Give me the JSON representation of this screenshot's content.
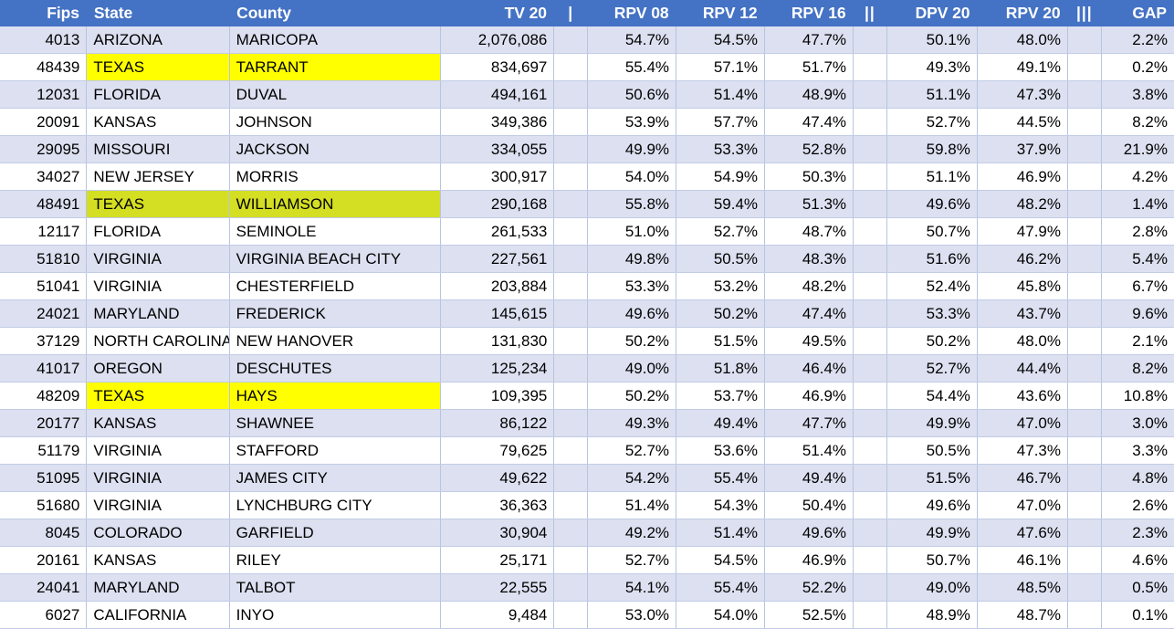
{
  "table": {
    "columns": [
      {
        "key": "fips",
        "label": "Fips",
        "align": "num",
        "type": "data"
      },
      {
        "key": "state",
        "label": "State",
        "align": "txt",
        "type": "data"
      },
      {
        "key": "county",
        "label": "County",
        "align": "txt",
        "type": "data"
      },
      {
        "key": "tv20",
        "label": "TV 20",
        "align": "num",
        "type": "data"
      },
      {
        "key": "sep1",
        "label": "|",
        "align": "sepc",
        "type": "separator"
      },
      {
        "key": "rpv08",
        "label": "RPV 08",
        "align": "num",
        "type": "data"
      },
      {
        "key": "rpv12",
        "label": "RPV 12",
        "align": "num",
        "type": "data"
      },
      {
        "key": "rpv16",
        "label": "RPV 16",
        "align": "num",
        "type": "data"
      },
      {
        "key": "sep2",
        "label": "||",
        "align": "sepc",
        "type": "separator"
      },
      {
        "key": "dpv20",
        "label": "DPV 20",
        "align": "num",
        "type": "data"
      },
      {
        "key": "rpv20",
        "label": "RPV 20",
        "align": "num",
        "type": "data"
      },
      {
        "key": "sep3",
        "label": "|||",
        "align": "sepc",
        "type": "separator"
      },
      {
        "key": "gap",
        "label": "GAP",
        "align": "num",
        "type": "data"
      }
    ],
    "colors": {
      "header_background": "#4472C4",
      "header_text": "#FFFFFF",
      "row_alt_background": "#DCE0F0",
      "row_plain_background": "#FFFFFF",
      "highlight_yellow": "#FFFF00",
      "highlight_olive": "#D4DE23",
      "gridline": "#B8C4E0"
    },
    "rows": [
      {
        "fips": "4013",
        "state": "ARIZONA",
        "county": "MARICOPA",
        "tv20": "2,076,086",
        "sep1": "",
        "rpv08": "54.7%",
        "rpv12": "54.5%",
        "rpv16": "47.7%",
        "sep2": "",
        "dpv20": "50.1%",
        "rpv20": "48.0%",
        "sep3": "",
        "gap": "2.2%",
        "highlight": ""
      },
      {
        "fips": "48439",
        "state": "TEXAS",
        "county": "TARRANT",
        "tv20": "834,697",
        "sep1": "",
        "rpv08": "55.4%",
        "rpv12": "57.1%",
        "rpv16": "51.7%",
        "sep2": "",
        "dpv20": "49.3%",
        "rpv20": "49.1%",
        "sep3": "",
        "gap": "0.2%",
        "highlight": "yellow"
      },
      {
        "fips": "12031",
        "state": "FLORIDA",
        "county": "DUVAL",
        "tv20": "494,161",
        "sep1": "",
        "rpv08": "50.6%",
        "rpv12": "51.4%",
        "rpv16": "48.9%",
        "sep2": "",
        "dpv20": "51.1%",
        "rpv20": "47.3%",
        "sep3": "",
        "gap": "3.8%",
        "highlight": ""
      },
      {
        "fips": "20091",
        "state": "KANSAS",
        "county": "JOHNSON",
        "tv20": "349,386",
        "sep1": "",
        "rpv08": "53.9%",
        "rpv12": "57.7%",
        "rpv16": "47.4%",
        "sep2": "",
        "dpv20": "52.7%",
        "rpv20": "44.5%",
        "sep3": "",
        "gap": "8.2%",
        "highlight": ""
      },
      {
        "fips": "29095",
        "state": "MISSOURI",
        "county": "JACKSON",
        "tv20": "334,055",
        "sep1": "",
        "rpv08": "49.9%",
        "rpv12": "53.3%",
        "rpv16": "52.8%",
        "sep2": "",
        "dpv20": "59.8%",
        "rpv20": "37.9%",
        "sep3": "",
        "gap": "21.9%",
        "highlight": ""
      },
      {
        "fips": "34027",
        "state": "NEW JERSEY",
        "county": "MORRIS",
        "tv20": "300,917",
        "sep1": "",
        "rpv08": "54.0%",
        "rpv12": "54.9%",
        "rpv16": "50.3%",
        "sep2": "",
        "dpv20": "51.1%",
        "rpv20": "46.9%",
        "sep3": "",
        "gap": "4.2%",
        "highlight": ""
      },
      {
        "fips": "48491",
        "state": "TEXAS",
        "county": "WILLIAMSON",
        "tv20": "290,168",
        "sep1": "",
        "rpv08": "55.8%",
        "rpv12": "59.4%",
        "rpv16": "51.3%",
        "sep2": "",
        "dpv20": "49.6%",
        "rpv20": "48.2%",
        "sep3": "",
        "gap": "1.4%",
        "highlight": "olive"
      },
      {
        "fips": "12117",
        "state": "FLORIDA",
        "county": "SEMINOLE",
        "tv20": "261,533",
        "sep1": "",
        "rpv08": "51.0%",
        "rpv12": "52.7%",
        "rpv16": "48.7%",
        "sep2": "",
        "dpv20": "50.7%",
        "rpv20": "47.9%",
        "sep3": "",
        "gap": "2.8%",
        "highlight": ""
      },
      {
        "fips": "51810",
        "state": "VIRGINIA",
        "county": "VIRGINIA BEACH CITY",
        "tv20": "227,561",
        "sep1": "",
        "rpv08": "49.8%",
        "rpv12": "50.5%",
        "rpv16": "48.3%",
        "sep2": "",
        "dpv20": "51.6%",
        "rpv20": "46.2%",
        "sep3": "",
        "gap": "5.4%",
        "highlight": ""
      },
      {
        "fips": "51041",
        "state": "VIRGINIA",
        "county": "CHESTERFIELD",
        "tv20": "203,884",
        "sep1": "",
        "rpv08": "53.3%",
        "rpv12": "53.2%",
        "rpv16": "48.2%",
        "sep2": "",
        "dpv20": "52.4%",
        "rpv20": "45.8%",
        "sep3": "",
        "gap": "6.7%",
        "highlight": ""
      },
      {
        "fips": "24021",
        "state": "MARYLAND",
        "county": "FREDERICK",
        "tv20": "145,615",
        "sep1": "",
        "rpv08": "49.6%",
        "rpv12": "50.2%",
        "rpv16": "47.4%",
        "sep2": "",
        "dpv20": "53.3%",
        "rpv20": "43.7%",
        "sep3": "",
        "gap": "9.6%",
        "highlight": ""
      },
      {
        "fips": "37129",
        "state": "NORTH CAROLINA",
        "county": "NEW HANOVER",
        "tv20": "131,830",
        "sep1": "",
        "rpv08": "50.2%",
        "rpv12": "51.5%",
        "rpv16": "49.5%",
        "sep2": "",
        "dpv20": "50.2%",
        "rpv20": "48.0%",
        "sep3": "",
        "gap": "2.1%",
        "highlight": ""
      },
      {
        "fips": "41017",
        "state": "OREGON",
        "county": "DESCHUTES",
        "tv20": "125,234",
        "sep1": "",
        "rpv08": "49.0%",
        "rpv12": "51.8%",
        "rpv16": "46.4%",
        "sep2": "",
        "dpv20": "52.7%",
        "rpv20": "44.4%",
        "sep3": "",
        "gap": "8.2%",
        "highlight": ""
      },
      {
        "fips": "48209",
        "state": "TEXAS",
        "county": "HAYS",
        "tv20": "109,395",
        "sep1": "",
        "rpv08": "50.2%",
        "rpv12": "53.7%",
        "rpv16": "46.9%",
        "sep2": "",
        "dpv20": "54.4%",
        "rpv20": "43.6%",
        "sep3": "",
        "gap": "10.8%",
        "highlight": "yellow"
      },
      {
        "fips": "20177",
        "state": "KANSAS",
        "county": "SHAWNEE",
        "tv20": "86,122",
        "sep1": "",
        "rpv08": "49.3%",
        "rpv12": "49.4%",
        "rpv16": "47.7%",
        "sep2": "",
        "dpv20": "49.9%",
        "rpv20": "47.0%",
        "sep3": "",
        "gap": "3.0%",
        "highlight": ""
      },
      {
        "fips": "51179",
        "state": "VIRGINIA",
        "county": "STAFFORD",
        "tv20": "79,625",
        "sep1": "",
        "rpv08": "52.7%",
        "rpv12": "53.6%",
        "rpv16": "51.4%",
        "sep2": "",
        "dpv20": "50.5%",
        "rpv20": "47.3%",
        "sep3": "",
        "gap": "3.3%",
        "highlight": ""
      },
      {
        "fips": "51095",
        "state": "VIRGINIA",
        "county": "JAMES CITY",
        "tv20": "49,622",
        "sep1": "",
        "rpv08": "54.2%",
        "rpv12": "55.4%",
        "rpv16": "49.4%",
        "sep2": "",
        "dpv20": "51.5%",
        "rpv20": "46.7%",
        "sep3": "",
        "gap": "4.8%",
        "highlight": ""
      },
      {
        "fips": "51680",
        "state": "VIRGINIA",
        "county": "LYNCHBURG CITY",
        "tv20": "36,363",
        "sep1": "",
        "rpv08": "51.4%",
        "rpv12": "54.3%",
        "rpv16": "50.4%",
        "sep2": "",
        "dpv20": "49.6%",
        "rpv20": "47.0%",
        "sep3": "",
        "gap": "2.6%",
        "highlight": ""
      },
      {
        "fips": "8045",
        "state": "COLORADO",
        "county": "GARFIELD",
        "tv20": "30,904",
        "sep1": "",
        "rpv08": "49.2%",
        "rpv12": "51.4%",
        "rpv16": "49.6%",
        "sep2": "",
        "dpv20": "49.9%",
        "rpv20": "47.6%",
        "sep3": "",
        "gap": "2.3%",
        "highlight": ""
      },
      {
        "fips": "20161",
        "state": "KANSAS",
        "county": "RILEY",
        "tv20": "25,171",
        "sep1": "",
        "rpv08": "52.7%",
        "rpv12": "54.5%",
        "rpv16": "46.9%",
        "sep2": "",
        "dpv20": "50.7%",
        "rpv20": "46.1%",
        "sep3": "",
        "gap": "4.6%",
        "highlight": ""
      },
      {
        "fips": "24041",
        "state": "MARYLAND",
        "county": "TALBOT",
        "tv20": "22,555",
        "sep1": "",
        "rpv08": "54.1%",
        "rpv12": "55.4%",
        "rpv16": "52.2%",
        "sep2": "",
        "dpv20": "49.0%",
        "rpv20": "48.5%",
        "sep3": "",
        "gap": "0.5%",
        "highlight": ""
      },
      {
        "fips": "6027",
        "state": "CALIFORNIA",
        "county": "INYO",
        "tv20": "9,484",
        "sep1": "",
        "rpv08": "53.0%",
        "rpv12": "54.0%",
        "rpv16": "52.5%",
        "sep2": "",
        "dpv20": "48.9%",
        "rpv20": "48.7%",
        "sep3": "",
        "gap": "0.1%",
        "highlight": ""
      }
    ]
  }
}
